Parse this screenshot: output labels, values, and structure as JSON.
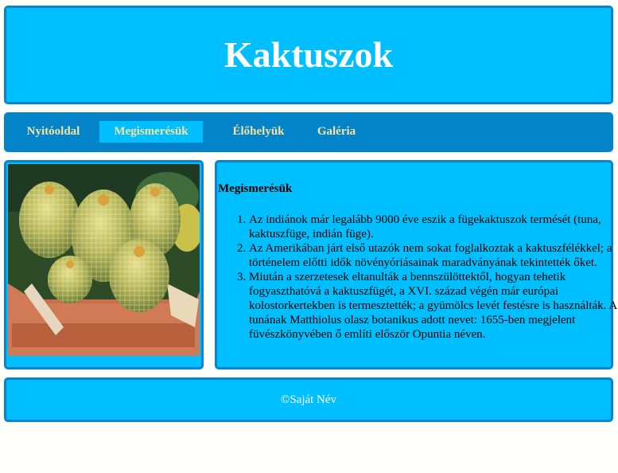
{
  "header": {
    "title": "Kaktuszok"
  },
  "nav": {
    "items": [
      {
        "label": "Nyitóoldal",
        "active": false
      },
      {
        "label": "Megismerésük",
        "active": true
      },
      {
        "label": "Élőhelyük",
        "active": false
      },
      {
        "label": "Galéria",
        "active": false
      }
    ]
  },
  "content": {
    "title": "Megismerésük",
    "list": [
      "Az indiánok már legalább 9000 éve eszik a fügekaktuszok termését (tuna, kaktuszfüge, indián füge).",
      "Az Amerikában járt első utazók nem sokat foglalkoztak a kaktuszfélékkel; a történelem előtti idők növényóriásainak maradványának tekintették őket.",
      "Miután a szerzetesek eltanulták a bennszülöttektől, hogyan tehetik fogyaszthatóvá a kaktuszfügét, a XVI. század végén már európai kolostorkertekben is termesztették; a gyümölcs levét festésre is használták. A tunának Matthiolus olasz botanikus adott nevet: 1655-ben megjelent füvészkönyvében ő említi először Opuntia néven."
    ]
  },
  "footer": {
    "text": "©Saját Név"
  },
  "colors": {
    "box_background": "#00bfff",
    "box_border": "#0884cc",
    "nav_background": "#0484c8",
    "nav_text": "#f6e3a0"
  }
}
